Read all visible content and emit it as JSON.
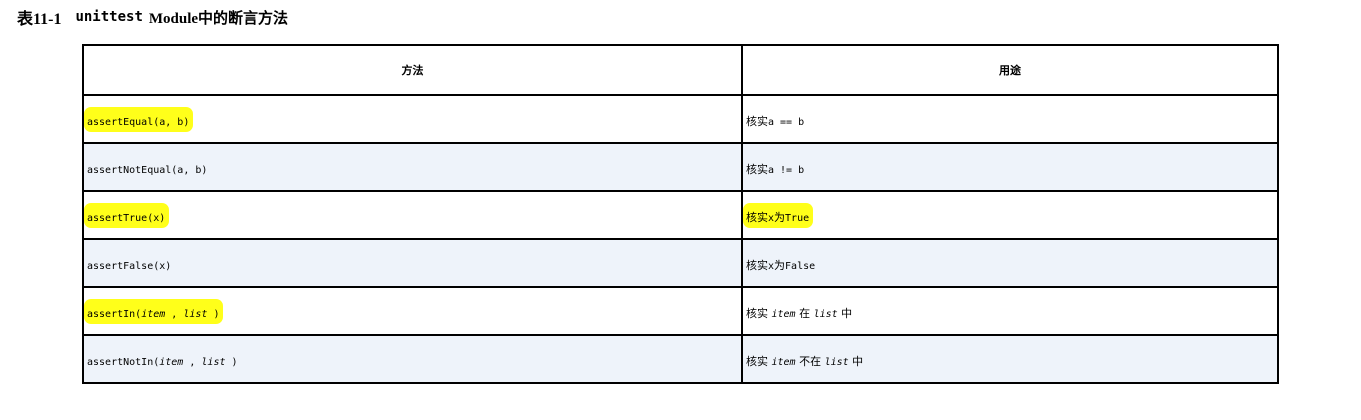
{
  "caption": {
    "number": "表11-1",
    "code": "unittest",
    "rest": "Module中的断言方法"
  },
  "table": {
    "headers": [
      "方法",
      "用途"
    ],
    "rows": [
      {
        "method": [
          "assertEqual(a, b)"
        ],
        "purpose": [
          "核实",
          "a == b"
        ]
      },
      {
        "method": [
          "assertNotEqual(a, b)"
        ],
        "purpose": [
          "核实",
          "a != b"
        ]
      },
      {
        "method": [
          "assertTrue(x)"
        ],
        "purpose": [
          "核实",
          "x",
          "为",
          "True"
        ]
      },
      {
        "method": [
          "assertFalse(x)"
        ],
        "purpose": [
          "核实",
          "x",
          "为",
          "False"
        ]
      },
      {
        "method": [
          "assertIn(",
          "item",
          " , ",
          "list",
          " )"
        ],
        "purpose": [
          "核实 ",
          "item",
          " 在 ",
          "list",
          " 中"
        ]
      },
      {
        "method": [
          "assertNotIn(",
          "item",
          " , ",
          "list",
          " )"
        ],
        "purpose": [
          "核实 ",
          "item",
          " 不在 ",
          "list",
          " 中"
        ]
      }
    ]
  },
  "highlight": {
    "color": "#ffff1a"
  }
}
